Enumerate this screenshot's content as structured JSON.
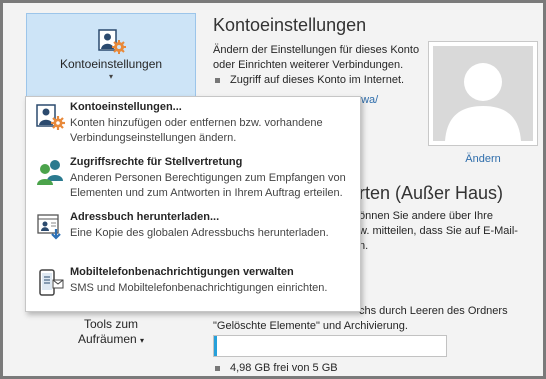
{
  "account_button": {
    "label": "Kontoeinstellungen",
    "caret": "▾",
    "icon": "account-settings-icon"
  },
  "tools_button": {
    "line1": "Tools zum",
    "line2": "Aufräumen",
    "caret": "▾"
  },
  "account": {
    "title": "Kontoeinstellungen",
    "description": "Ändern der Einstellungen für dieses Konto oder Einrichten weiterer Verbindungen.",
    "bullet": "Zugriff auf dieses Konto im Internet.",
    "link_fragment": "owa/",
    "change_photo": "Ändern"
  },
  "out_of_office": {
    "title_fragment": "rten (Außer Haus)",
    "desc_line1": "önnen Sie andere über Ihre",
    "desc_line2": "w. mitteilen, dass Sie auf E-Mail-",
    "desc_line3": "n."
  },
  "mailbox": {
    "text_fragment": "chs durch Leeren des Ordners",
    "text_line2": "\"Gelöschte Elemente\" und Archivierung.",
    "free_space": "4,98 GB frei von 5 GB",
    "used_fraction": 0.004
  },
  "menu": {
    "items": [
      {
        "title": "Kontoeinstellungen...",
        "description": "Konten hinzufügen oder entfernen bzw. vorhandene Verbindungseinstellungen ändern.",
        "icon": "account-settings-icon"
      },
      {
        "title": "Zugriffsrechte für Stellvertretung",
        "description": "Anderen Personen Berechtigungen zum Empfangen von Elementen und zum Antworten in Ihrem Auftrag erteilen.",
        "icon": "delegate-access-icon"
      },
      {
        "title": "Adressbuch herunterladen...",
        "description": "Eine Kopie des globalen Adressbuchs herunterladen.",
        "icon": "download-address-book-icon"
      },
      {
        "title": "Mobiltelefonbenachrichtigungen verwalten",
        "description": "SMS und Mobiltelefonbenachrichtigungen einrichten.",
        "icon": "mobile-notifications-icon"
      }
    ]
  }
}
